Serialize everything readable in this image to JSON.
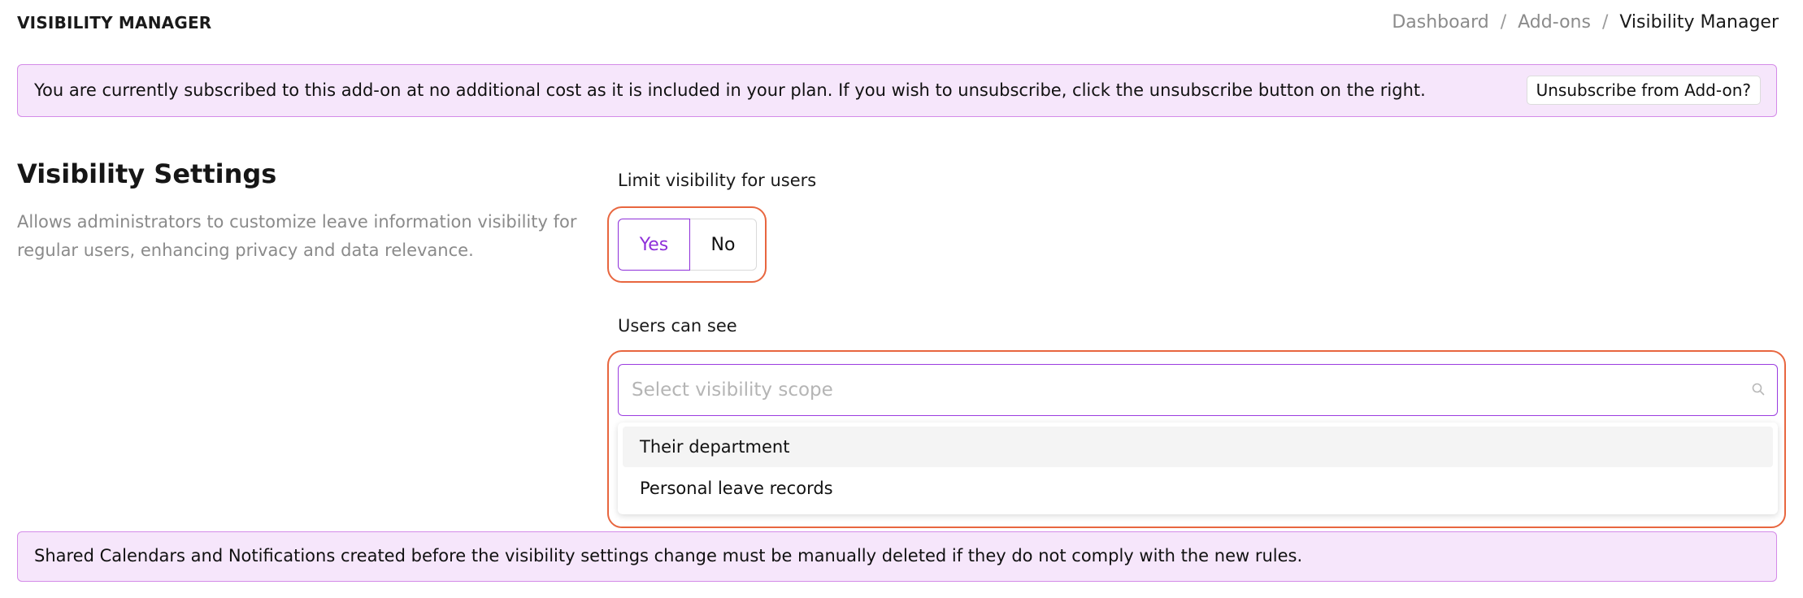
{
  "header": {
    "app_title": "VISIBILITY MANAGER",
    "breadcrumb": [
      "Dashboard",
      "Add-ons",
      "Visibility Manager"
    ],
    "breadcrumb_separator": "/"
  },
  "subscription_banner": {
    "text": "You are currently subscribed to this add-on at no additional cost as it is included in your plan. If you wish to unsubscribe, click the unsubscribe button on the right.",
    "button_label": "Unsubscribe from Add-on?"
  },
  "settings": {
    "title": "Visibility Settings",
    "description": "Allows administrators to customize leave information visibility for regular users, enhancing privacy and data relevance."
  },
  "limit_visibility": {
    "label": "Limit visibility for users",
    "options": [
      "Yes",
      "No"
    ],
    "selected": "Yes"
  },
  "users_can_see": {
    "label": "Users can see",
    "placeholder": "Select visibility scope",
    "value": "",
    "options": [
      "Their department",
      "Personal leave records"
    ],
    "hovered_option": "Their department"
  },
  "warning_banner": {
    "text": "Shared Calendars and Notifications created before the visibility settings change must be manually deleted if they do not comply with the new rules."
  },
  "colors": {
    "accent": "#8e2fd9",
    "banner_bg": "#f6e6fb",
    "banner_border": "#d48be8",
    "highlight_outline": "#e8663f"
  },
  "icons": {
    "search": "search-icon"
  }
}
